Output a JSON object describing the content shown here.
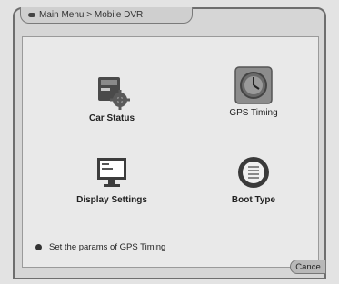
{
  "breadcrumb": "Main Menu > Mobile DVR",
  "menu_items": [
    {
      "label": "Car Status",
      "icon": "car-status-icon"
    },
    {
      "label": "GPS Timing",
      "icon": "gps-timing-icon"
    },
    {
      "label": "Display Settings",
      "icon": "monitor-icon"
    },
    {
      "label": "Boot Type",
      "icon": "boot-type-icon"
    }
  ],
  "status_text": "Set the params of GPS Timing",
  "cancel_label": "Cance"
}
